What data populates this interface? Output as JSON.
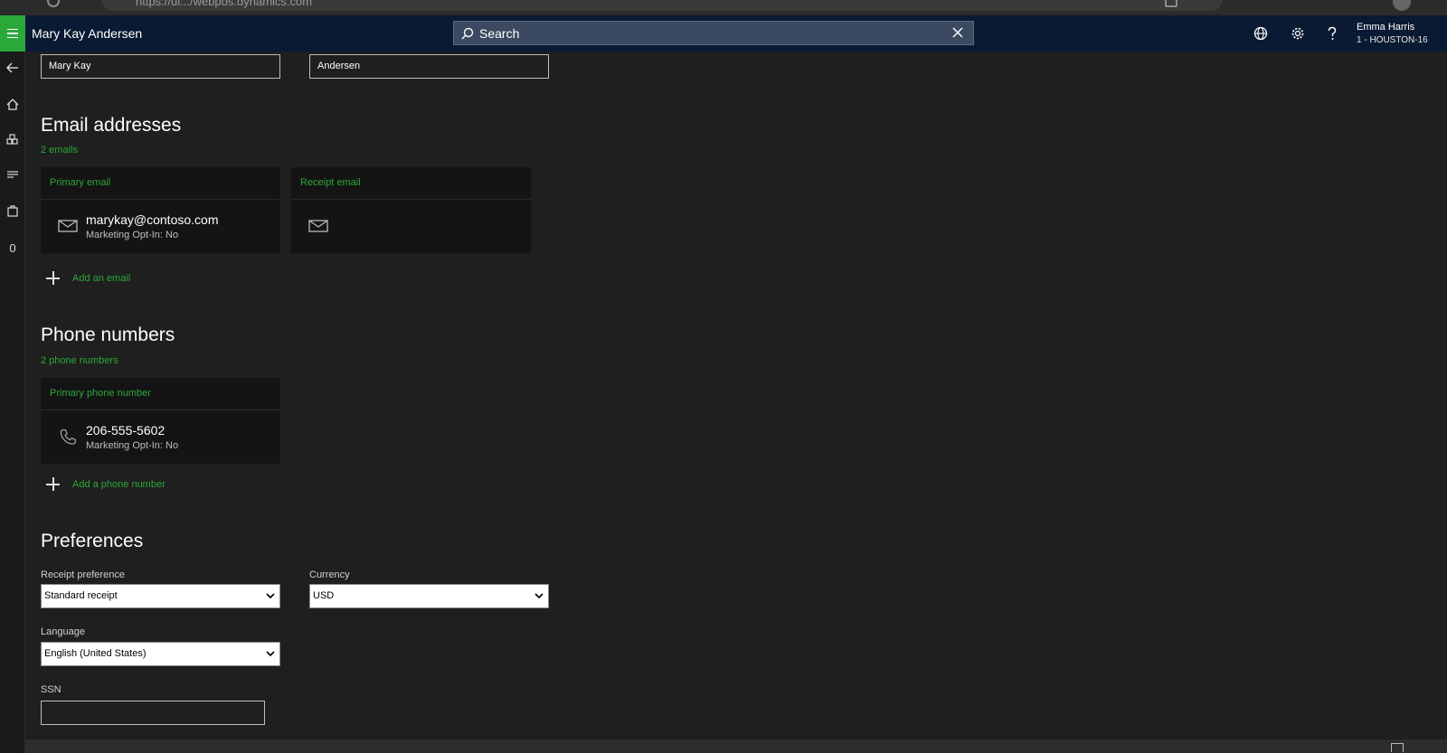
{
  "browser": {
    "url": "https://ui.../webpos.dynamics.com"
  },
  "header": {
    "title": "Mary Kay Andersen",
    "search_label": "Search",
    "user_name": "Emma Harris",
    "user_store": "1 - HOUSTON-16"
  },
  "leftnav": {
    "count": "0"
  },
  "name": {
    "first": "Mary Kay",
    "last": "Andersen"
  },
  "email": {
    "title": "Email addresses",
    "count": "2 emails",
    "cards": [
      {
        "heading": "Primary email",
        "value": "marykay@contoso.com",
        "optin": "Marketing Opt-In: No"
      },
      {
        "heading": "Receipt email",
        "value": "",
        "optin": ""
      }
    ],
    "add_label": "Add an email"
  },
  "phone": {
    "title": "Phone numbers",
    "count": "2 phone numbers",
    "cards": [
      {
        "heading": "Primary phone number",
        "value": "206-555-5602",
        "optin": "Marketing Opt-In: No"
      }
    ],
    "add_label": "Add a phone number"
  },
  "preferences": {
    "title": "Preferences",
    "receipt_label": "Receipt preference",
    "receipt_value": "Standard receipt",
    "currency_label": "Currency",
    "currency_value": "USD",
    "language_label": "Language",
    "language_value": "English (United States)",
    "ssn_label": "SSN",
    "ssn_value": ""
  },
  "colors": {
    "accent": "#2aa83a",
    "topbar": "#0b1a33",
    "background": "#1f1f1f",
    "card": "#141414"
  }
}
